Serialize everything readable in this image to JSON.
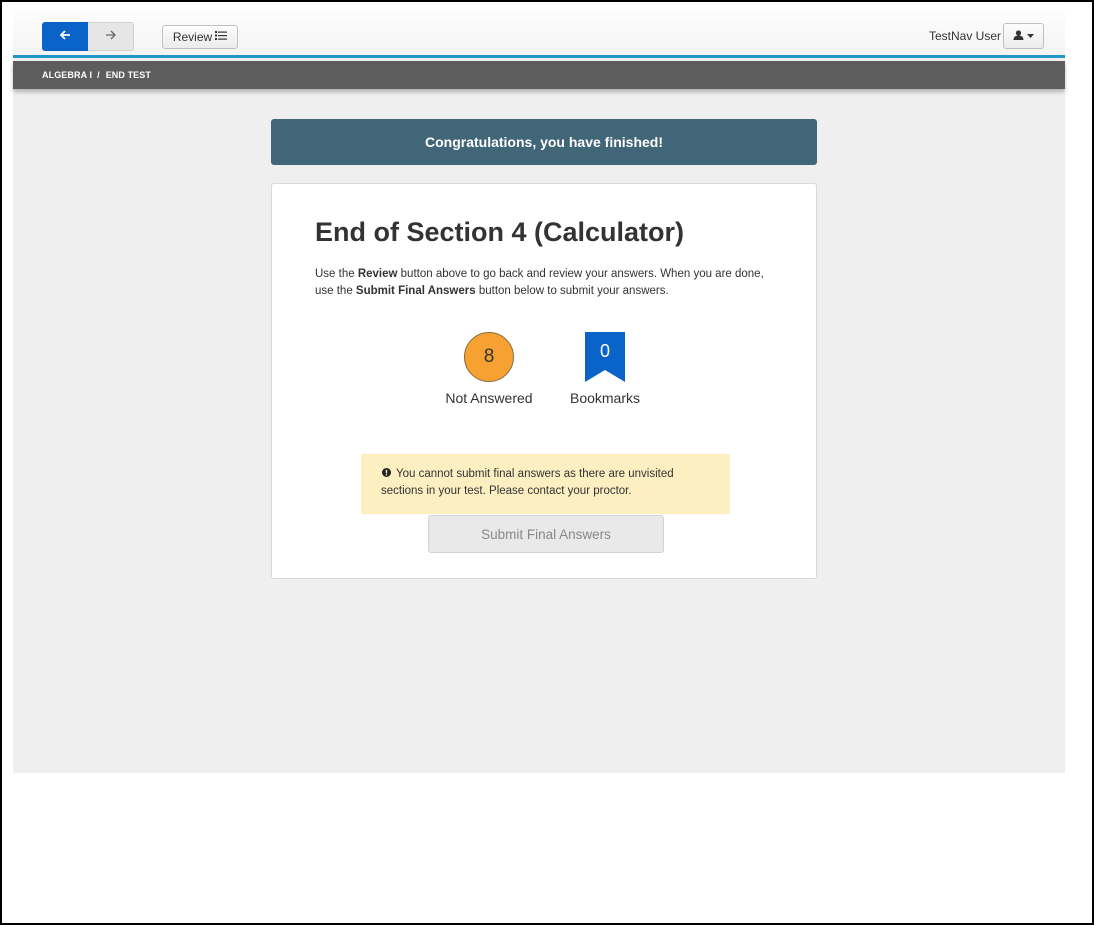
{
  "header": {
    "back_icon": "arrow-left-icon",
    "forward_icon": "arrow-right-icon",
    "review_label": "Review",
    "review_icon": "list-icon",
    "user_name": "TestNav User",
    "user_icon": "user-icon",
    "accent_color": "#2196c9",
    "back_button_color": "#0a63c9"
  },
  "breadcrumb": {
    "course": "ALGEBRA I",
    "separator": "/",
    "page": "END TEST"
  },
  "banner": {
    "text": "Congratulations, you have finished!",
    "color": "#416678"
  },
  "section": {
    "title": "End of Section 4 (Calculator)",
    "desc_part1": "Use the ",
    "desc_bold1": "Review",
    "desc_part2": " button above to go back and review your answers. When you are done, use the ",
    "desc_bold2": "Submit Final Answers",
    "desc_part3": " button below to submit your answers."
  },
  "stats": {
    "not_answered_count": "8",
    "not_answered_label": "Not Answered",
    "not_answered_color": "#f6a131",
    "bookmarks_count": "0",
    "bookmarks_label": "Bookmarks",
    "bookmarks_color": "#0a63c9"
  },
  "warning": {
    "icon": "info-circle-icon",
    "text": "You cannot submit final answers as there are unvisited sections in your test. Please contact your proctor."
  },
  "submit": {
    "label": "Submit Final Answers",
    "disabled": true
  }
}
